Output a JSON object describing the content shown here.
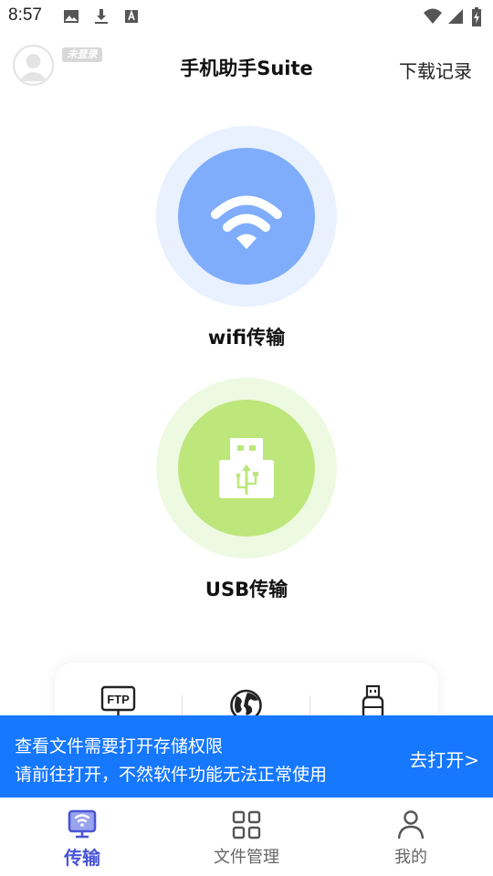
{
  "status_bar": {
    "time": "8:57",
    "left_icons": [
      "image-icon",
      "download-icon",
      "font-icon"
    ],
    "right_icons": [
      "wifi-signal-icon",
      "cell-signal-icon",
      "battery-icon"
    ]
  },
  "header": {
    "login_badge": "未登录",
    "title": "手机助手Suite",
    "download_log": "下载记录"
  },
  "transfer_options": [
    {
      "label": "wifi传输",
      "icon": "wifi-icon",
      "color": "#7fadfb"
    },
    {
      "label": "USB传输",
      "icon": "usb-icon",
      "color": "#bde77b"
    }
  ],
  "tools": [
    {
      "icon": "ftp-icon",
      "label": "FTP"
    },
    {
      "icon": "globe-icon"
    },
    {
      "icon": "usb-drive-icon"
    }
  ],
  "banner": {
    "line1": "查看文件需要打开存储权限",
    "line2": "请前往打开，不然软件功能无法正常使用",
    "action": "去打开>"
  },
  "bottom_nav": [
    {
      "label": "传输",
      "icon": "transfer-icon",
      "active": true
    },
    {
      "label": "文件管理",
      "icon": "grid-icon",
      "active": false
    },
    {
      "label": "我的",
      "icon": "person-icon",
      "active": false
    }
  ],
  "colors": {
    "accent": "#4955d6",
    "banner": "#1677ff",
    "wifi": "#7fadfb",
    "usb": "#bde77b"
  }
}
